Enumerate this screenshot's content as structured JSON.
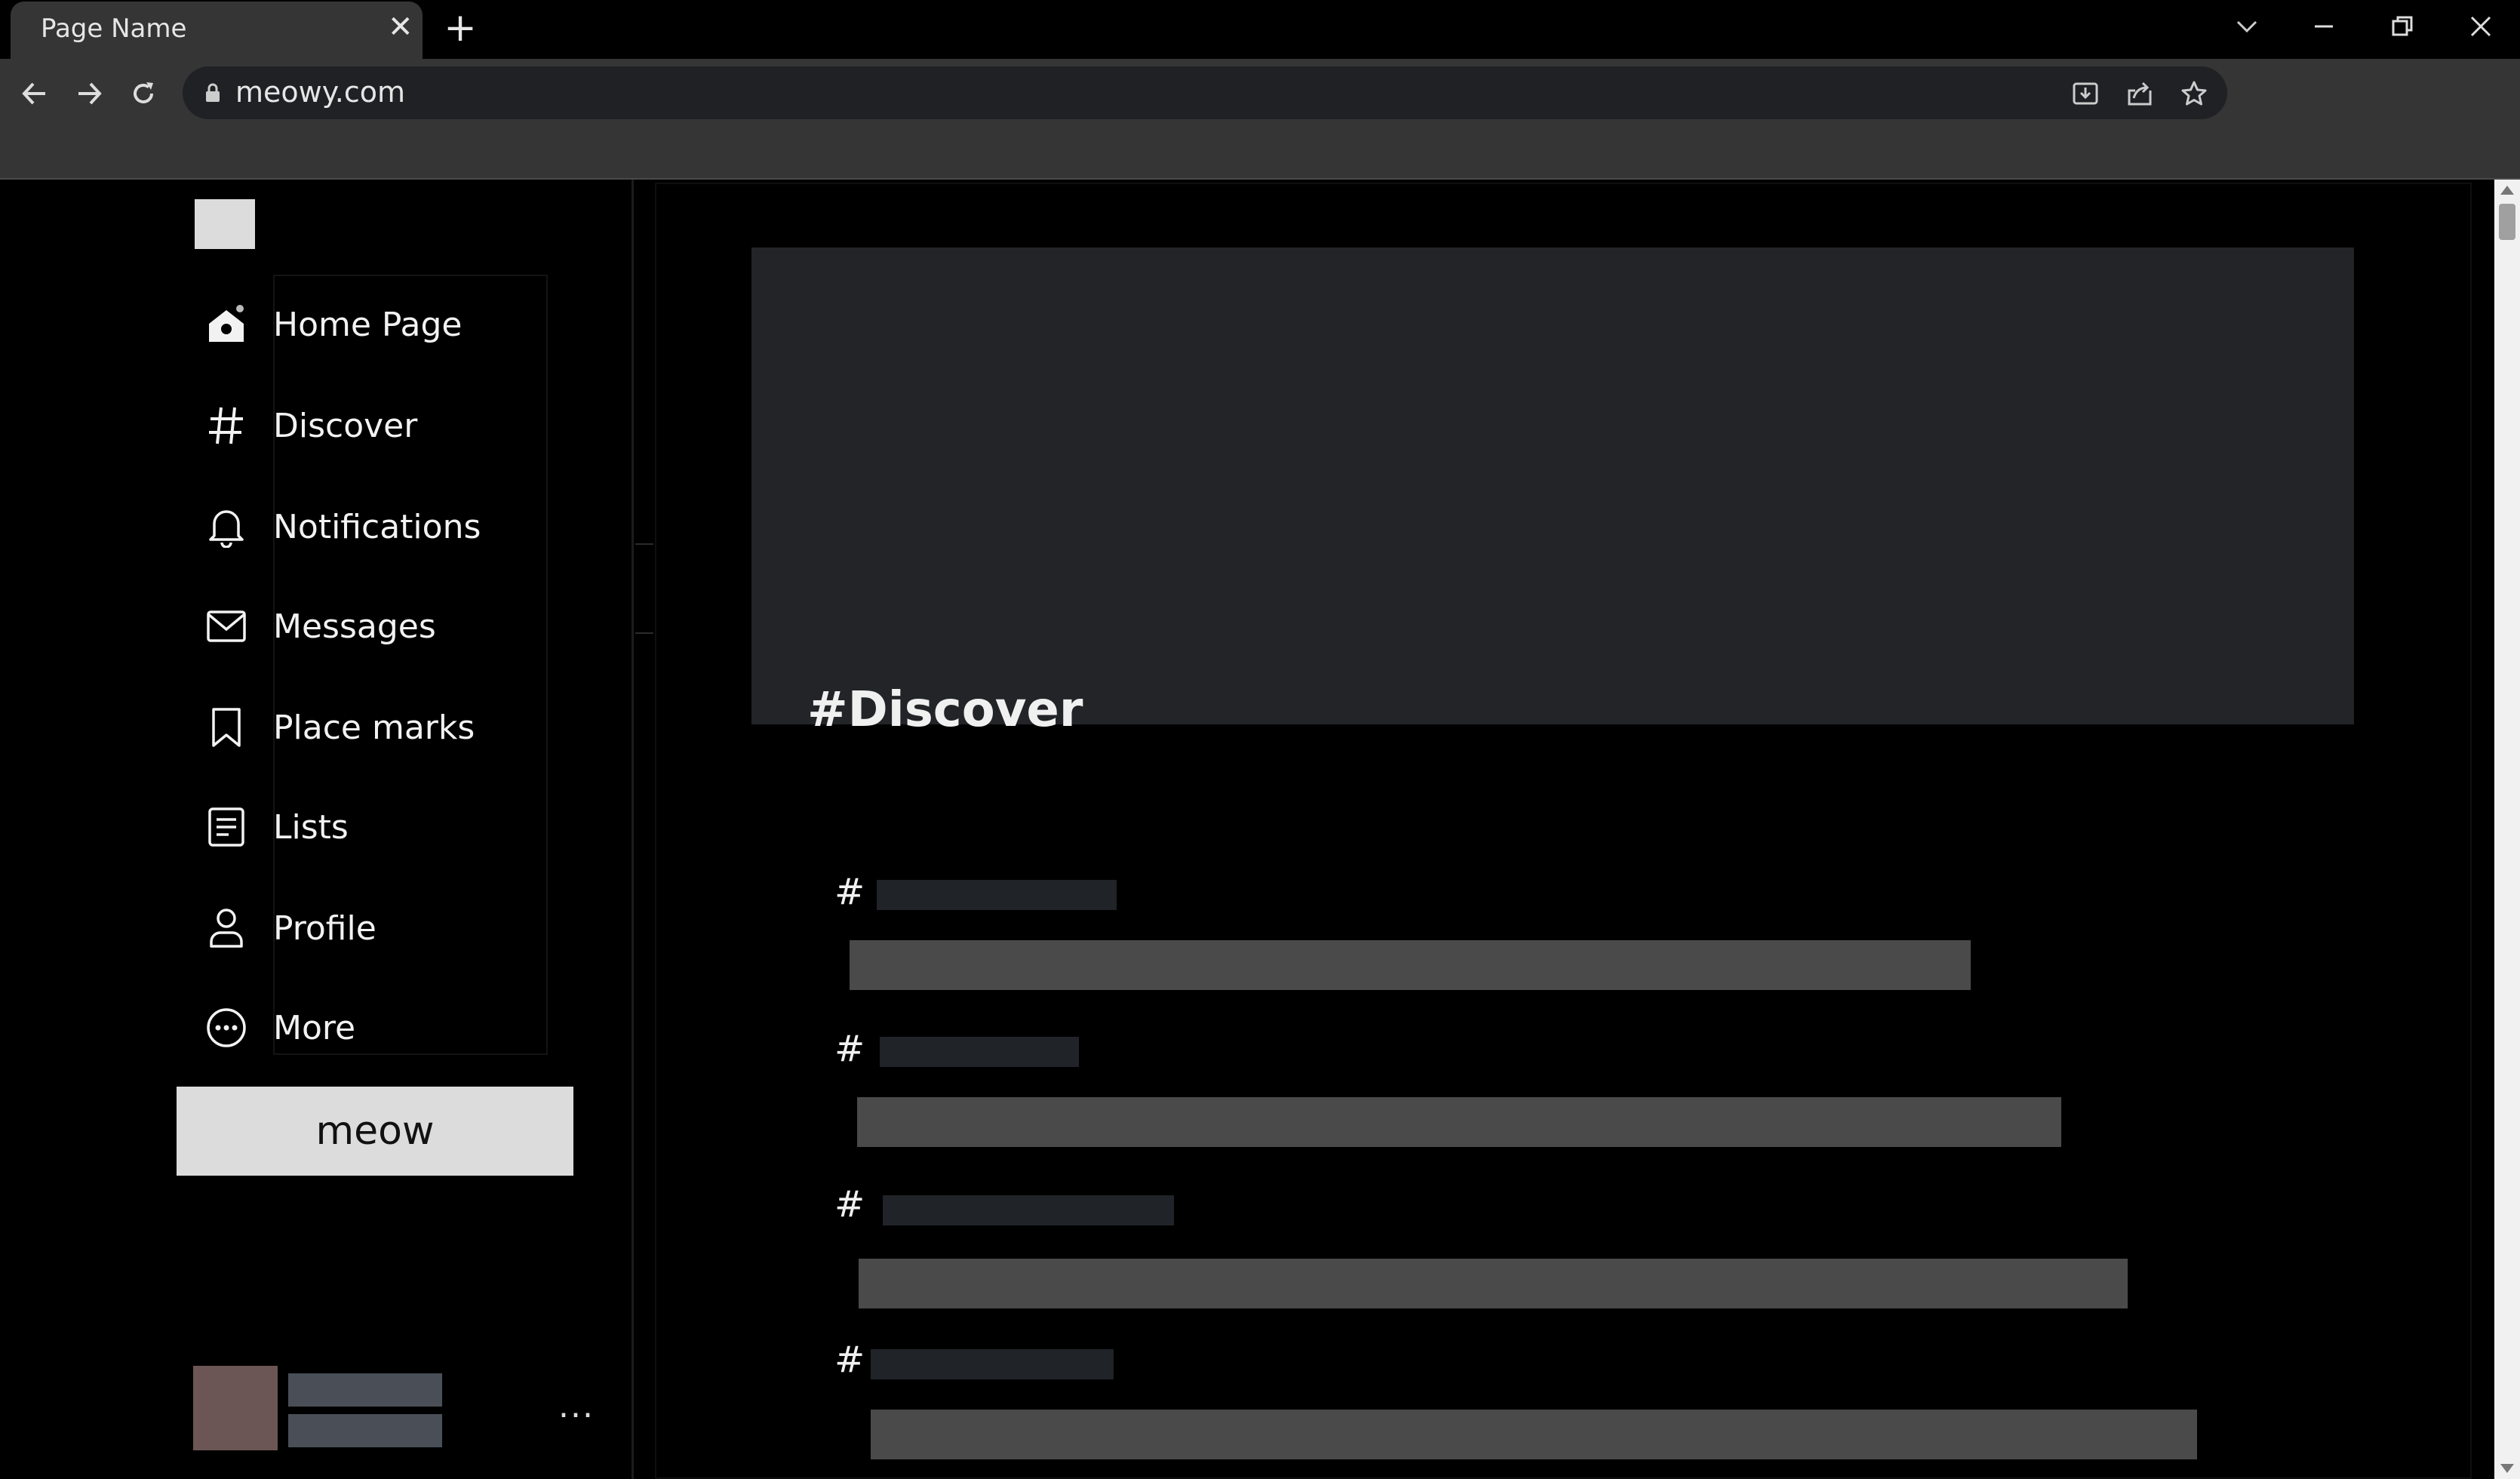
{
  "browser": {
    "tab_title": "Page Name",
    "tab_close": "✕",
    "new_tab": "+",
    "url": "meowy.com"
  },
  "sidebar": {
    "items": [
      {
        "label": "Home Page",
        "icon": "home-icon"
      },
      {
        "label": "Discover",
        "icon": "hashtag-icon"
      },
      {
        "label": "Notifications",
        "icon": "bell-icon"
      },
      {
        "label": "Messages",
        "icon": "mail-icon"
      },
      {
        "label": "Place marks",
        "icon": "bookmark-icon"
      },
      {
        "label": "Lists",
        "icon": "list-icon"
      },
      {
        "label": "Profile",
        "icon": "profile-icon"
      },
      {
        "label": "More",
        "icon": "more-circle-icon"
      }
    ],
    "action_button": "meow",
    "account_more": "..."
  },
  "main": {
    "title": "#Discover",
    "trends": [
      {
        "hash": "#"
      },
      {
        "hash": "#"
      },
      {
        "hash": "#"
      },
      {
        "hash": "#"
      }
    ]
  },
  "colors": {
    "background": "#000000",
    "chrome": "#353535",
    "omnibox": "#202124",
    "banner": "#222428",
    "placeholder": "#4a4a4a",
    "button": "#dcdcdc",
    "avatar": "#6b5555"
  }
}
